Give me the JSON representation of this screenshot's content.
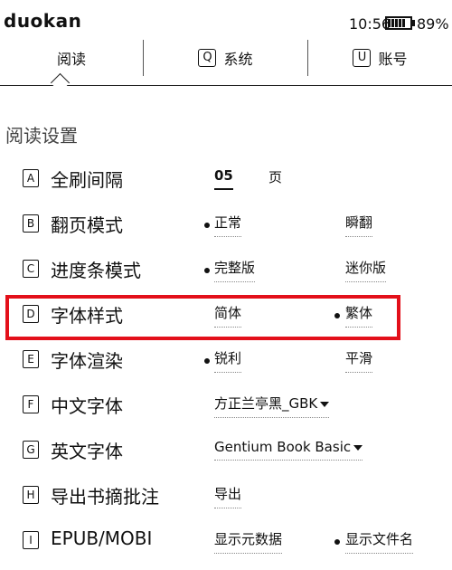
{
  "status": {
    "brand": "duokan",
    "time": "10:56",
    "battery_pct": "89%"
  },
  "tabs": [
    {
      "key": "",
      "label": "阅读"
    },
    {
      "key": "Q",
      "label": "系统"
    },
    {
      "key": "U",
      "label": "账号"
    }
  ],
  "section_title": "阅读设置",
  "rows": [
    {
      "key": "A",
      "label": "全刷间隔",
      "opt1": "05",
      "opt2": "页"
    },
    {
      "key": "B",
      "label": "翻页模式",
      "opt1": "正常",
      "opt2": "瞬翻"
    },
    {
      "key": "C",
      "label": "进度条模式",
      "opt1": "完整版",
      "opt2": "迷你版"
    },
    {
      "key": "D",
      "label": "字体样式",
      "opt1": "简体",
      "opt2": "繁体"
    },
    {
      "key": "E",
      "label": "字体渲染",
      "opt1": "锐利",
      "opt2": "平滑"
    },
    {
      "key": "F",
      "label": "中文字体",
      "opt1": "方正兰亭黑_GBK"
    },
    {
      "key": "G",
      "label": "英文字体",
      "opt1": "Gentium Book Basic"
    },
    {
      "key": "H",
      "label": "导出书摘批注",
      "opt1": "导出"
    },
    {
      "key": "I",
      "label": "EPUB/MOBI",
      "opt1": "显示元数据",
      "opt2": "显示文件名"
    }
  ],
  "colors": {
    "highlight": "#e3101a"
  }
}
